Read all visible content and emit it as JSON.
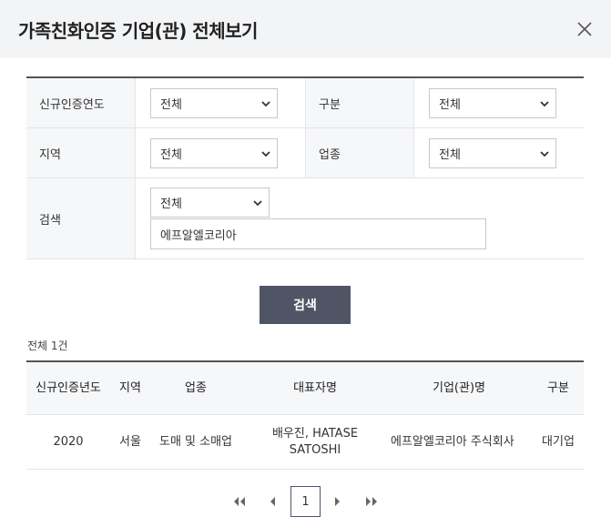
{
  "dialog": {
    "title": "가족친화인증 기업(관) 전체보기"
  },
  "filters": {
    "year_label": "신규인증연도",
    "year_value": "전체",
    "type_label": "구분",
    "type_value": "전체",
    "region_label": "지역",
    "region_value": "전체",
    "industry_label": "업종",
    "industry_value": "전체",
    "search_label": "검색",
    "search_scope_value": "전체",
    "search_text": "에프알엘코리아"
  },
  "search_button": "검색",
  "result_count": "전체 1건",
  "table": {
    "headers": {
      "year": "신규인증년도",
      "region": "지역",
      "industry": "업종",
      "ceo": "대표자명",
      "company": "기업(관)명",
      "type": "구분"
    },
    "rows": [
      {
        "year": "2020",
        "region": "서울",
        "industry": "도매 및 소매업",
        "ceo": "배우진, HATASE SATOSHI",
        "company": "에프알엘코리아 주식회사",
        "type": "대기업"
      }
    ]
  },
  "pagination": {
    "current_page": "1"
  },
  "icons": [
    "close-icon",
    "chevron-down-icon",
    "first-page-icon",
    "prev-page-icon",
    "next-page-icon",
    "last-page-icon"
  ]
}
